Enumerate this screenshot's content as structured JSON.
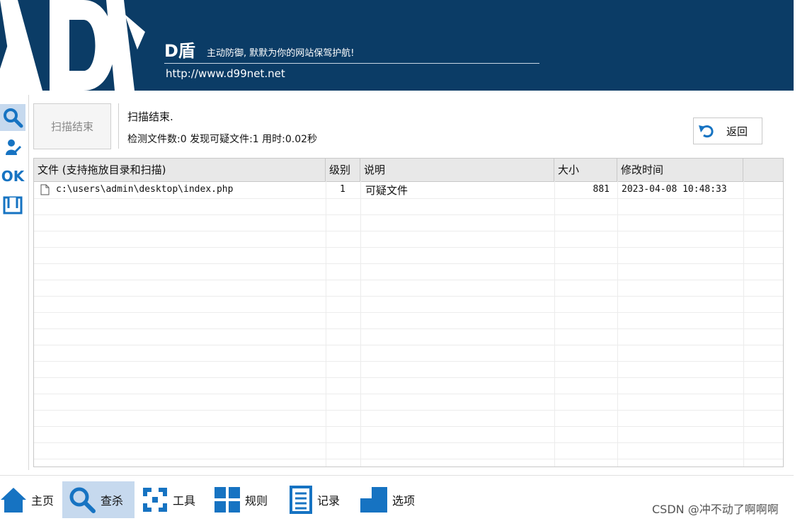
{
  "header": {
    "brand": "D盾",
    "slogan": "主动防御, 默默为你的网站保驾护航!",
    "url": "http://www.d99net.net"
  },
  "left_tools": [
    {
      "icon": "search-icon"
    },
    {
      "icon": "user-clean-icon"
    },
    {
      "icon": "ok-icon",
      "text": "OK"
    },
    {
      "icon": "bracket-icon"
    }
  ],
  "scan": {
    "button_label": "扫描结束",
    "status_line1": "扫描结束.",
    "status_line2": "检测文件数:0 发现可疑文件:1 用时:0.02秒",
    "back_label": "返回"
  },
  "table": {
    "columns": [
      "文件 (支持拖放目录和扫描)",
      "级别",
      "说明",
      "大小",
      "修改时间"
    ],
    "rows": [
      {
        "file": "c:\\users\\admin\\desktop\\index.php",
        "level": "1",
        "desc": "可疑文件",
        "size": "881",
        "mtime": "2023-04-08 10:48:33"
      }
    ]
  },
  "nav": [
    {
      "label": "主页",
      "icon": "home-icon"
    },
    {
      "label": "查杀",
      "icon": "search-icon",
      "active": true
    },
    {
      "label": "工具",
      "icon": "tools-icon"
    },
    {
      "label": "规则",
      "icon": "rules-icon"
    },
    {
      "label": "记录",
      "icon": "records-icon"
    },
    {
      "label": "选项",
      "icon": "options-icon"
    }
  ],
  "watermark": "CSDN @冲不动了啊啊啊",
  "colors": {
    "header_bg": "#0b3c66",
    "accent": "#1673c2",
    "active_bg": "#c6d9ee"
  }
}
